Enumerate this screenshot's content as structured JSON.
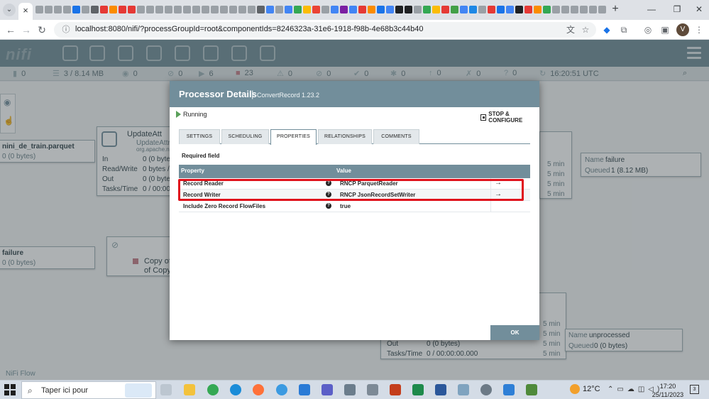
{
  "browser": {
    "address_url": "localhost:8080/nifi/?processGroupId=root&componentIds=8246323a-31e6-1918-f98b-4e68b3c44b40",
    "active_tab_close": "×",
    "new_tab": "+",
    "profile_initial": "V"
  },
  "nifi": {
    "status": {
      "active_threads": "0",
      "queued": "3 / 8.14 MB",
      "transmitting": "0",
      "not_transmitting": "0",
      "running": "6",
      "stopped": "23",
      "invalid": "0",
      "disabled": "0",
      "up_to_date": "0",
      "locally_modified": "0",
      "stale": "0",
      "errors": "0",
      "sync_failure": "0",
      "refresh_time": "16:20:51 UTC"
    },
    "flow_label": "NiFi Flow",
    "canvas": {
      "conn_left_name": "nini_de_train.parquet",
      "conn_left_queued": "0 (0 bytes)",
      "proc_update_name": "UpdateAtt",
      "proc_update_type": "UpdateAttri",
      "proc_update_bundle": "org.apache.ni",
      "stat_in_label": "In",
      "stat_in_value": "0 (0 bytes)",
      "stat_rw_label": "Read/Write",
      "stat_rw_value": "0 bytes /",
      "stat_out_label": "Out",
      "stat_out_value": "0 (0 bytes)",
      "stat_tasks_label": "Tasks/Time",
      "stat_tasks_value": "0 / 00:00:",
      "conn_failure_left_name": "failure",
      "conn_failure_left_queued": "0 (0 bytes)",
      "proc_copy_name_1": "Copy of",
      "proc_copy_name_2": "of Copy",
      "five_min": "5 min",
      "conn_right_name_label": "Name",
      "conn_right_name": "failure",
      "conn_right_queued_label": "Queued",
      "conn_right_queued": "1 (8.12 MB)",
      "conn_unproc_name_label": "Name",
      "conn_unproc_name": "unprocessed",
      "conn_unproc_queued_label": "Queued",
      "conn_unproc_queued": "0 (0 bytes)",
      "bottom_out_label": "Out",
      "bottom_out_value": "0 (0 bytes)",
      "bottom_tasks_label": "Tasks/Time",
      "bottom_tasks_value": "0 / 00:00:00.000"
    }
  },
  "dialog": {
    "title": "Processor Details",
    "separator": "|",
    "subtitle": "ConvertRecord 1.23.2",
    "run_state": "Running",
    "stop_configure": "STOP & CONFIGURE",
    "tabs": [
      "SETTINGS",
      "SCHEDULING",
      "PROPERTIES",
      "RELATIONSHIPS",
      "COMMENTS"
    ],
    "required_field": "Required field",
    "table": {
      "col_property": "Property",
      "col_value": "Value",
      "rows": [
        {
          "name": "Record Reader",
          "value": "RNCP ParquetReader",
          "arrow": "→"
        },
        {
          "name": "Record Writer",
          "value": "RNCP JsonRecordSetWriter",
          "arrow": "→"
        },
        {
          "name": "Include Zero Record FlowFiles",
          "value": "true",
          "arrow": ""
        }
      ]
    },
    "ok": "OK"
  },
  "taskbar": {
    "search_placeholder": "Taper ici pour",
    "temperature": "12°C",
    "time": "17:20",
    "date": "25/11/2023",
    "notifications": "3"
  }
}
